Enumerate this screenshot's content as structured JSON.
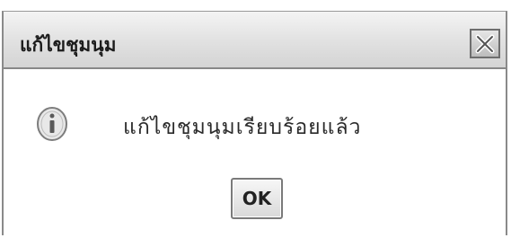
{
  "dialog": {
    "title": "แก้ไขชุมนุม",
    "message": "แก้ไขชุมนุมเรียบร้อยแล้ว",
    "ok_label": "OK",
    "icon": "info-icon",
    "close_icon": "close-icon"
  }
}
